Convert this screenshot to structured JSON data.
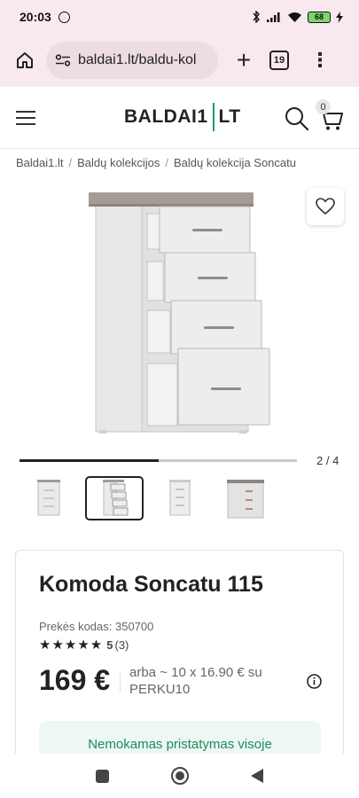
{
  "status_bar": {
    "time": "20:03",
    "battery": "68"
  },
  "browser": {
    "url": "baldai1.lt/baldu-kol",
    "tab_count": "19",
    "plus": "+",
    "menu": "⋮"
  },
  "site": {
    "logo_left": "BALDAI1",
    "logo_right": "LT",
    "cart_count": "0"
  },
  "breadcrumb": {
    "items": [
      "Baldai1.lt",
      "Baldų kolekcijos",
      "Baldų kolekcija Soncatu"
    ],
    "separator": "/"
  },
  "gallery": {
    "counter": "2 / 4",
    "progress": 0.5,
    "thumbnails": [
      "thumbnail-1",
      "thumbnail-2",
      "thumbnail-3",
      "thumbnail-4"
    ],
    "active_index": 1
  },
  "product": {
    "title": "Komoda Soncatu 115",
    "sku_label": "Prekės kodas: 350700",
    "stars": "★★★★★",
    "rating_value": "5",
    "rating_count": "(3)",
    "price": "169 €",
    "installment": "arba ~ 10 x 16.90 € su PERKU10",
    "shipping": "Nemokamas pristatymas visoje"
  },
  "colors": {
    "accent": "#1e9c6a",
    "status_bg": "#f7e9ef",
    "shipping_bg": "#edf7f3"
  }
}
